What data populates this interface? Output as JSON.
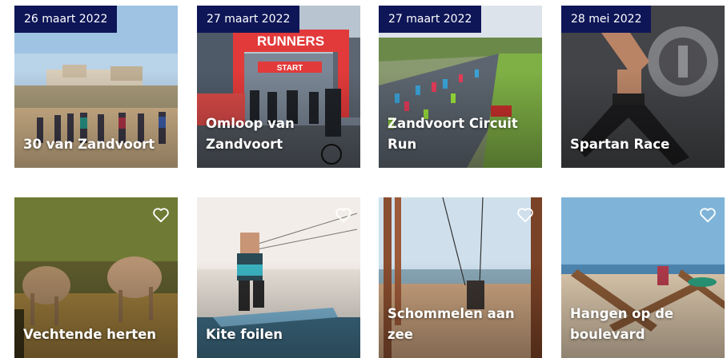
{
  "cards": [
    {
      "date": "26 maart 2022",
      "title": "30 van Zandvoort",
      "icon": ""
    },
    {
      "date": "27 maart 2022",
      "title": "Omloop van Zandvoort",
      "banner": "RUNNERS",
      "gate": "START"
    },
    {
      "date": "27 maart 2022",
      "title": "Zandvoort Circuit Run"
    },
    {
      "date": "28 mei 2022",
      "title": "Spartan Race"
    },
    {
      "title": "Vechtende herten",
      "icon": "heart-outline-icon"
    },
    {
      "title": "Kite foilen",
      "icon": "heart-outline-icon"
    },
    {
      "title": "Schommelen aan zee",
      "icon": "heart-outline-icon"
    },
    {
      "title": "Hangen op de boulevard",
      "icon": "heart-outline-icon"
    }
  ],
  "colors": {
    "date_badge": "#0e1657",
    "text": "#ffffff"
  }
}
